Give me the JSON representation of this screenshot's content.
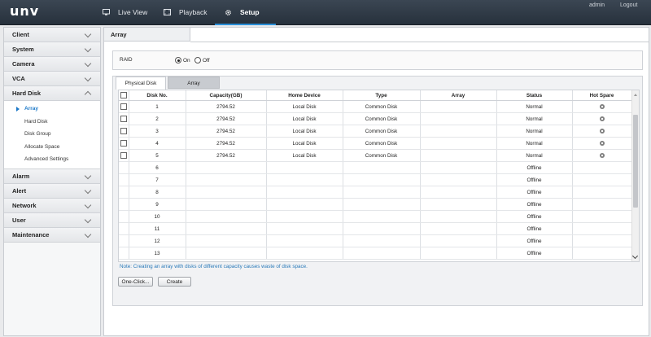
{
  "brand": {
    "logo_text": "unv"
  },
  "topnav": {
    "items": [
      {
        "label": "Live View",
        "icon": "monitor-icon"
      },
      {
        "label": "Playback",
        "icon": "film-icon"
      },
      {
        "label": "Setup",
        "icon": "gear-icon",
        "active": true
      }
    ],
    "user": "admin",
    "logout": "Logout"
  },
  "sidebar": {
    "groups": [
      {
        "label": "Client"
      },
      {
        "label": "System"
      },
      {
        "label": "Camera"
      },
      {
        "label": "VCA"
      },
      {
        "label": "Hard Disk",
        "expanded": true
      },
      {
        "label": "Alarm"
      },
      {
        "label": "Alert"
      },
      {
        "label": "Network"
      },
      {
        "label": "User"
      },
      {
        "label": "Maintenance"
      }
    ],
    "hard_disk_items": [
      "Array",
      "Hard Disk",
      "Disk Group",
      "Allocate Space",
      "Advanced Settings"
    ]
  },
  "page": {
    "title": "Array",
    "raid": {
      "label": "RAID",
      "on": "On",
      "off": "Off",
      "selected": "On"
    },
    "tabs": [
      "Physical Disk",
      "Array"
    ],
    "table": {
      "columns": [
        "",
        "Disk No.",
        "Capacity(GB)",
        "Home Device",
        "Type",
        "Array",
        "Status",
        "Hot Spare"
      ],
      "rows": [
        [
          "1",
          "2794.52",
          "Local Disk",
          "Common Disk",
          "",
          "Normal",
          true,
          true
        ],
        [
          "2",
          "2794.52",
          "Local Disk",
          "Common Disk",
          "",
          "Normal",
          true,
          true
        ],
        [
          "3",
          "2794.52",
          "Local Disk",
          "Common Disk",
          "",
          "Normal",
          true,
          true
        ],
        [
          "4",
          "2794.52",
          "Local Disk",
          "Common Disk",
          "",
          "Normal",
          true,
          true
        ],
        [
          "5",
          "2794.52",
          "Local Disk",
          "Common Disk",
          "",
          "Normal",
          true,
          true
        ],
        [
          "6",
          "",
          "",
          "",
          "",
          "Offline",
          false,
          false
        ],
        [
          "7",
          "",
          "",
          "",
          "",
          "Offline",
          false,
          false
        ],
        [
          "8",
          "",
          "",
          "",
          "",
          "Offline",
          false,
          false
        ],
        [
          "9",
          "",
          "",
          "",
          "",
          "Offline",
          false,
          false
        ],
        [
          "10",
          "",
          "",
          "",
          "",
          "Offline",
          false,
          false
        ],
        [
          "11",
          "",
          "",
          "",
          "",
          "Offline",
          false,
          false
        ],
        [
          "12",
          "",
          "",
          "",
          "",
          "Offline",
          false,
          false
        ],
        [
          "13",
          "",
          "",
          "",
          "",
          "Offline",
          false,
          false
        ]
      ]
    },
    "note": "Note: Creating an array with disks of different capacity causes waste of disk space.",
    "buttons": {
      "one_click": "One-Click...",
      "create": "Create"
    }
  },
  "colors": {
    "accent": "#2a8fd8",
    "topbar": "#2f3a46",
    "note": "#2a7ab9",
    "active_menu": "#1b78c8"
  }
}
